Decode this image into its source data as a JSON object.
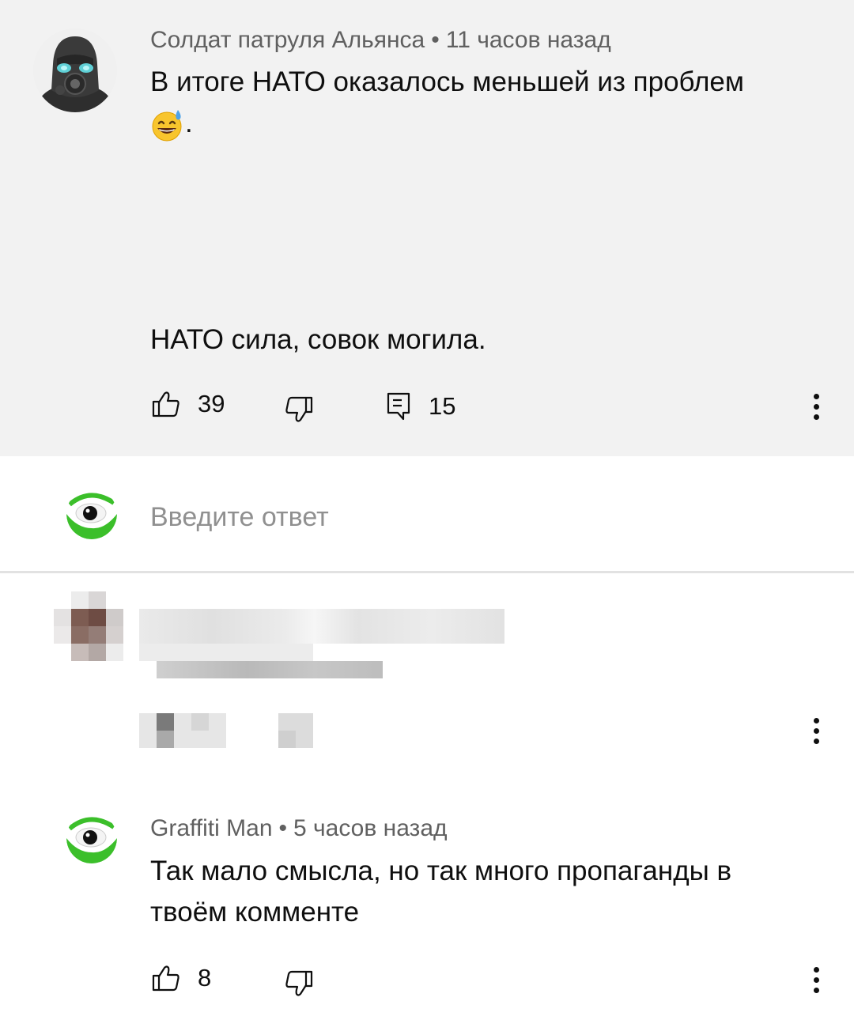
{
  "comments": [
    {
      "author": "Солдат патруля Альянса",
      "separator": "•",
      "time": "11 часов назад",
      "text_line1": "В итоге НАТО оказалось меньшей из проблем",
      "text_line2_suffix": ".",
      "text_last": "НАТО сила, совок могила.",
      "likes": "39",
      "replies": "15"
    },
    {
      "author": "Graffiti Man",
      "separator": "•",
      "time": "5 часов назад",
      "text_line1": "Так мало смысла, но так много пропаганды в",
      "text_line2": "твоём комменте",
      "likes": "8"
    }
  ],
  "reply_box": {
    "placeholder": "Введите ответ"
  },
  "icons": {
    "like": "thumbs-up-icon",
    "dislike": "thumbs-down-icon",
    "reply": "comment-icon",
    "more": "more-vert-icon",
    "emoji": "grinning-face-with-sweat"
  },
  "colors": {
    "top_background": "#f2f2f2",
    "meta_text": "#606060",
    "avatar_green": "#3bbf2a"
  }
}
